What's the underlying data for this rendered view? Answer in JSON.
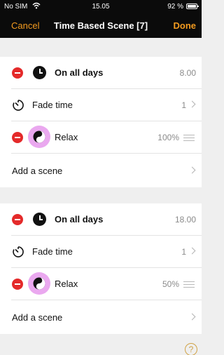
{
  "status_bar": {
    "carrier": "No SIM",
    "time": "15.05",
    "battery": "92 %",
    "icons": [
      "wifi-icon",
      "battery-icon"
    ]
  },
  "nav": {
    "cancel_label": "Cancel",
    "title": "Time Based Scene [7]",
    "done_label": "Done"
  },
  "colors": {
    "accent": "#f39b1f",
    "nav_background": "#0b0b0b",
    "delete": "#e42a2a",
    "scene_icon_background": "#eaa8ef"
  },
  "schedules": [
    {
      "days_label": "On all days",
      "time": "8.00",
      "fade_label": "Fade time",
      "fade_value": "1",
      "scene_name": "Relax",
      "scene_level": "100%",
      "add_scene_label": "Add a scene"
    },
    {
      "days_label": "On all days",
      "time": "18.00",
      "fade_label": "Fade time",
      "fade_value": "1",
      "scene_name": "Relax",
      "scene_level": "50%",
      "add_scene_label": "Add a scene"
    }
  ],
  "help_label": "?"
}
